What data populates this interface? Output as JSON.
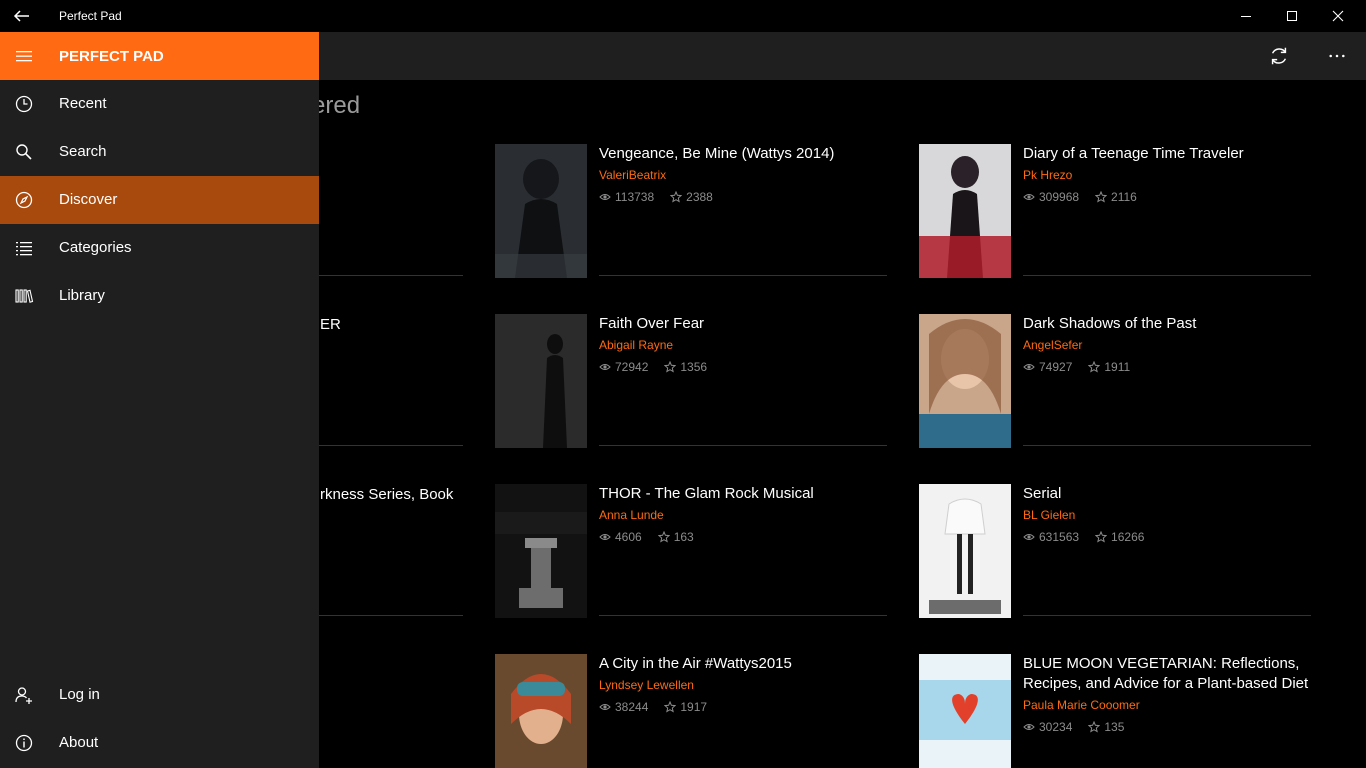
{
  "window": {
    "title": "Perfect Pad"
  },
  "sidebar": {
    "brand": "PERFECT PAD",
    "items": [
      {
        "label": "Recent",
        "icon": "clock-icon"
      },
      {
        "label": "Search",
        "icon": "search-icon"
      },
      {
        "label": "Discover",
        "icon": "compass-icon",
        "active": true
      },
      {
        "label": "Categories",
        "icon": "list-icon"
      },
      {
        "label": "Library",
        "icon": "library-icon"
      }
    ],
    "bottom_items": [
      {
        "label": "Log in",
        "icon": "add-user-icon"
      },
      {
        "label": "About",
        "icon": "info-icon"
      }
    ]
  },
  "main": {
    "heading_partial": "vered",
    "partial_titles": [
      "ER",
      "rkness Series, Book"
    ],
    "books": [
      {
        "title": "Vengeance, Be Mine (Wattys 2014)",
        "author": "ValeriBeatrix",
        "views": "113738",
        "stars": "2388"
      },
      {
        "title": "Diary of a Teenage Time Traveler",
        "author": "Pk Hrezo",
        "views": "309968",
        "stars": "2116"
      },
      {
        "title": "Faith Over Fear",
        "author": "Abigail Rayne",
        "views": "72942",
        "stars": "1356"
      },
      {
        "title": "Dark Shadows of the Past",
        "author": "AngelSefer",
        "views": "74927",
        "stars": "1911"
      },
      {
        "title": "THOR - The Glam Rock Musical",
        "author": "Anna Lunde",
        "views": "4606",
        "stars": "163"
      },
      {
        "title": "Serial",
        "author": "BL Gielen",
        "views": "631563",
        "stars": "16266"
      },
      {
        "title": "A City in the Air #Wattys2015",
        "author": "Lyndsey Lewellen",
        "views": "38244",
        "stars": "1917"
      },
      {
        "title": "BLUE MOON VEGETARIAN: Reflections, Recipes, and Advice for a Plant-based Diet",
        "author": "Paula Marie Cooomer",
        "views": "30234",
        "stars": "135"
      }
    ]
  },
  "colors": {
    "accent": "#ff6a13",
    "active_nav": "#a84a0d",
    "panel": "#1f1f1f"
  }
}
